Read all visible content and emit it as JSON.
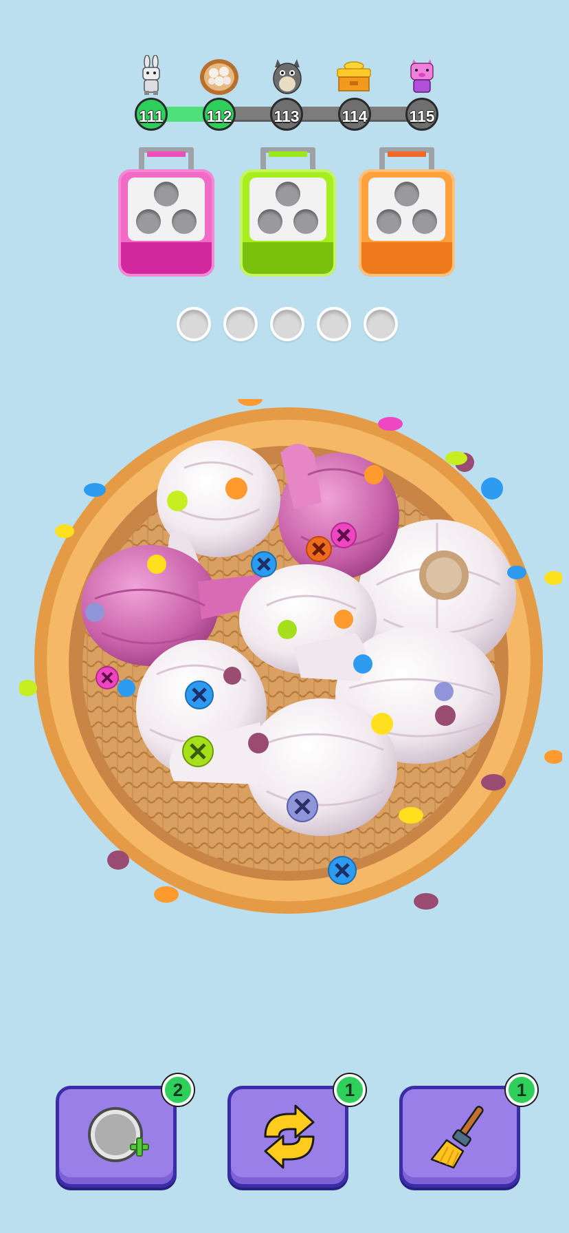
{
  "levels": {
    "nodes": [
      "111",
      "112",
      "113",
      "114",
      "115"
    ],
    "completed_count": 2,
    "icons": [
      "bunny-icon",
      "dumpling-basket-icon",
      "totoro-icon",
      "gold-ingot-icon",
      "pig-icon"
    ]
  },
  "boxes": [
    {
      "color": "#ec4fb8",
      "accent": "#c81f95",
      "label": "pink-screw-box"
    },
    {
      "color": "#9be81a",
      "accent": "#72b80c",
      "label": "lime-screw-box"
    },
    {
      "color": "#ff9b2e",
      "accent": "#e5741a",
      "label": "orange-screw-box"
    }
  ],
  "slots": {
    "count": 5
  },
  "board": {
    "objects": [
      "garlic-bulb",
      "garlic-bulb",
      "purple-garlic-bulb",
      "purple-garlic-bulb",
      "garlic-bulb",
      "garlic-bulb",
      "garlic-bulb"
    ],
    "container": "wicker-basket"
  },
  "tools": [
    {
      "name": "add-slot-button",
      "icon": "add-hole-icon",
      "count": "2"
    },
    {
      "name": "shuffle-button",
      "icon": "shuffle-arrows-icon",
      "count": "1"
    },
    {
      "name": "broom-button",
      "icon": "broom-icon",
      "count": "1"
    }
  ],
  "colors": {
    "background": "#bcdff0",
    "progress_done": "#2fcf5c",
    "progress_todo": "#6f6f6f",
    "button": "#9b7fe8",
    "button_border": "#3b2ca8",
    "badge": "#2fcf5c"
  }
}
